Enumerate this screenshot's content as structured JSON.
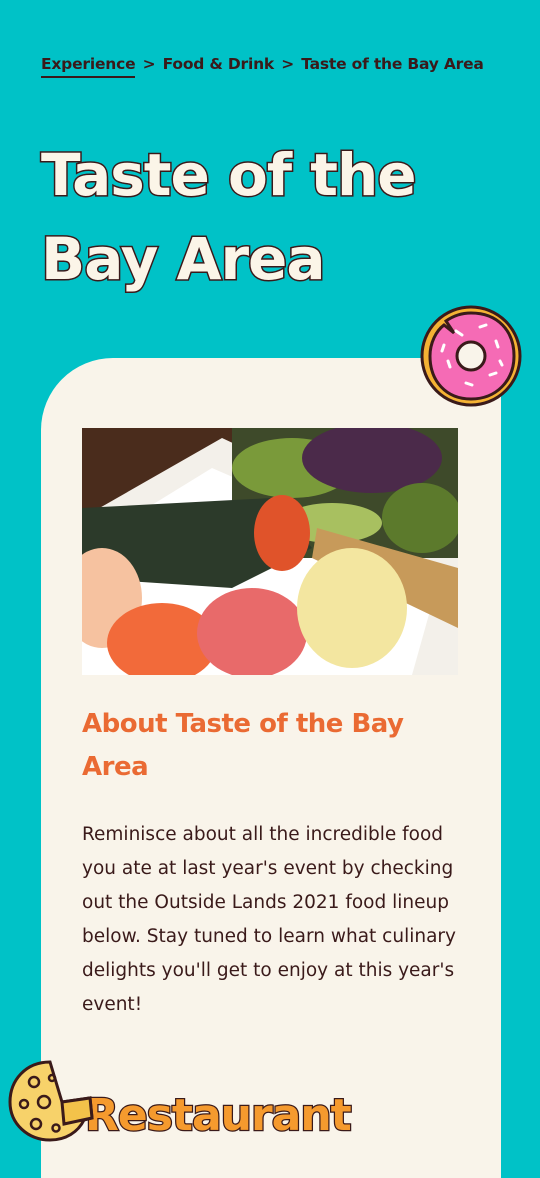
{
  "breadcrumb": {
    "items": [
      "Experience",
      "Food & Drink",
      "Taste of the Bay Area"
    ],
    "separator": ">"
  },
  "hero": {
    "title_line1": "Taste of the",
    "title_line2": "Bay Area"
  },
  "card": {
    "about_title": "About Taste of the Bay Area",
    "about_body": "Reminisce about all the incredible food you ate at last year's event by checking out the Outside Lands 2021 food lineup below. Stay tuned to learn what culinary delights you'll get to enjoy at this year's event!",
    "section_title": "Restaurant"
  },
  "icons": {
    "donut": "donut-icon",
    "cheese": "cheese-icon"
  },
  "colors": {
    "background": "#00c2c7",
    "card": "#f9f4ea",
    "accent": "#ea6a33",
    "text": "#3a1a1a",
    "hero_text": "#fbf5e8"
  }
}
